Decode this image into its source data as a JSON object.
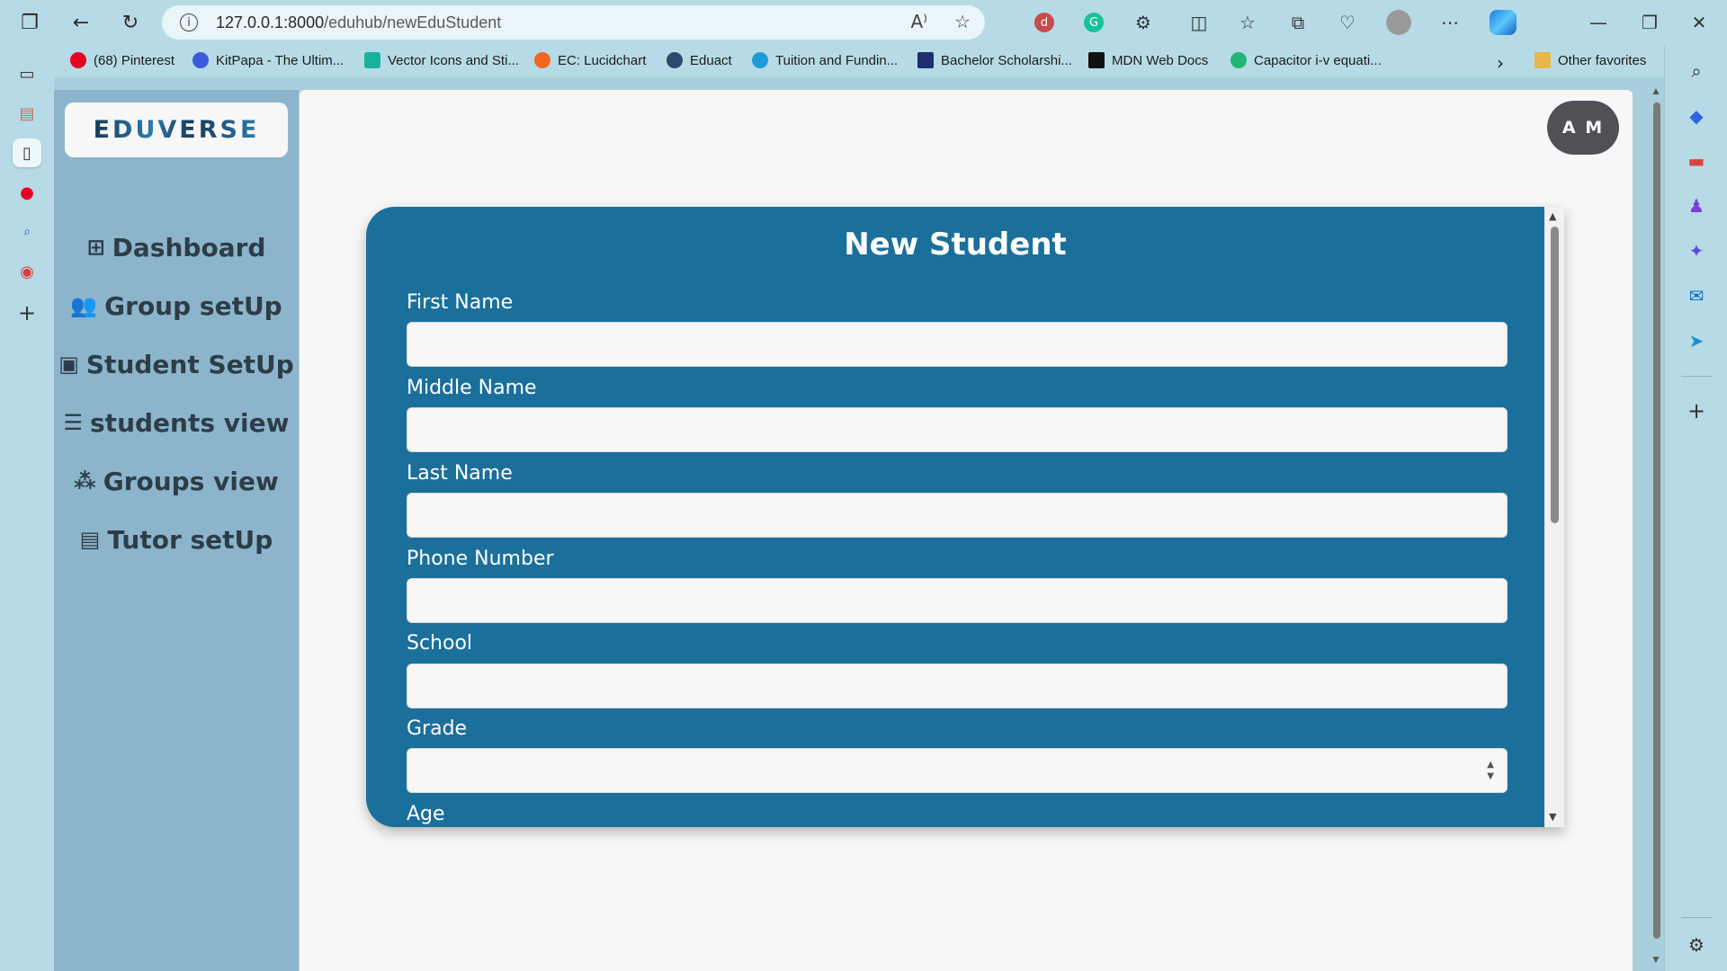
{
  "browser": {
    "url_host": "127.0.0.1:8000",
    "url_path": "/eduhub/newEduStudent",
    "favorites": [
      {
        "label": "(68) Pinterest",
        "color": "#e60023"
      },
      {
        "label": "KitPapa - The Ultim...",
        "color": "#3a5bd9"
      },
      {
        "label": "Vector Icons and Sti...",
        "color": "#19b39a"
      },
      {
        "label": "EC: Lucidchart",
        "color": "#f26722"
      },
      {
        "label": "Eduact",
        "color": "#2b4a6b"
      },
      {
        "label": "Tuition and Fundin...",
        "color": "#1e9bd7"
      },
      {
        "label": "Bachelor Scholarshi...",
        "color": "#1d2f6f"
      },
      {
        "label": "MDN Web Docs",
        "color": "#111111"
      },
      {
        "label": "Capacitor i-v equati...",
        "color": "#22b573"
      }
    ],
    "other_favorites": "Other favorites"
  },
  "app": {
    "logo": "EDUVERSE",
    "avatar_initials": "A M",
    "nav": [
      {
        "label": "Dashboard",
        "icon": "grid-icon"
      },
      {
        "label": "Group setUp",
        "icon": "users-icon"
      },
      {
        "label": "Student SetUp",
        "icon": "id-card-icon"
      },
      {
        "label": "students view",
        "icon": "list-icon"
      },
      {
        "label": "Groups view",
        "icon": "people-group-icon"
      },
      {
        "label": "Tutor setUp",
        "icon": "tutor-board-icon"
      }
    ]
  },
  "form": {
    "title": "New Student",
    "fields": [
      {
        "label": "First Name",
        "value": ""
      },
      {
        "label": "Middle Name",
        "value": ""
      },
      {
        "label": "Last Name",
        "value": ""
      },
      {
        "label": "Phone Number",
        "value": ""
      },
      {
        "label": "School",
        "value": ""
      },
      {
        "label": "Grade",
        "value": ""
      },
      {
        "label": "Age",
        "value": ""
      }
    ]
  },
  "colors": {
    "card": "#1b6f9b",
    "sidebar": "#8cb5cc",
    "chrome": "#b7dbe6",
    "avatar": "#4f5157"
  }
}
